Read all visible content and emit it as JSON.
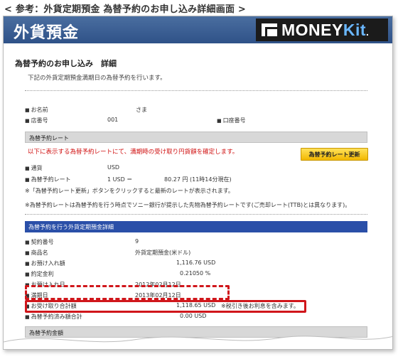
{
  "caption": "< 参考：外貨定期預金 為替予約のお申し込み詳細画面 >",
  "header": {
    "title": "外貨預金",
    "logo_main": "MONEY",
    "logo_kit": "Kit",
    "logo_dot": "."
  },
  "page": {
    "title": "為替予約のお申し込み　詳細",
    "intro": "下記の外貨定期預金満期日の為替予約を行います。"
  },
  "customer": {
    "name_label": "お名前",
    "name_value": "さま",
    "branch_label": "店番号",
    "branch_value": "001",
    "account_label": "口座番号"
  },
  "rate_section": {
    "header": "為替予約レート",
    "notice": "以下に表示する為替予約レートにて、満期時の受け取り円貨額を確定します。",
    "currency_label": "通貨",
    "currency_value": "USD",
    "rate_label": "為替予約レート",
    "rate_unit": "1 USD ＝",
    "rate_value": "80.27 円 (11時14分現在)",
    "update_button": "為替予約レート更新",
    "note1": "※「為替予約レート更新」ボタンをクリックすると最新のレートが表示されます。",
    "note2": "※為替予約レートは為替予約を行う時点でソニー銀行が提示した先物為替予約レートです(ご売却レート(TTB)とは異なります)。"
  },
  "deposit_section": {
    "header": "為替予約を行う外貨定期預金詳細",
    "rows": [
      {
        "label": "契約番号",
        "value": "9"
      },
      {
        "label": "商品名",
        "value": "外貨定期預金(米ドル)"
      },
      {
        "label": "お預け入れ額",
        "value": "1,116.76 USD"
      },
      {
        "label": "約定金利",
        "value": "0.21050 %"
      },
      {
        "label": "お預け入れ日",
        "value": "2012年02月12日"
      },
      {
        "label": "満期日",
        "value": "2013年02月12日"
      },
      {
        "label": "お受け取り合計額",
        "value": "1,118.65 USD",
        "note": "※税引き後お利息を含みます。"
      },
      {
        "label": "為替予約済み額合計",
        "value": "0.00 USD"
      }
    ]
  },
  "amount_section": {
    "header": "為替予約金額"
  }
}
